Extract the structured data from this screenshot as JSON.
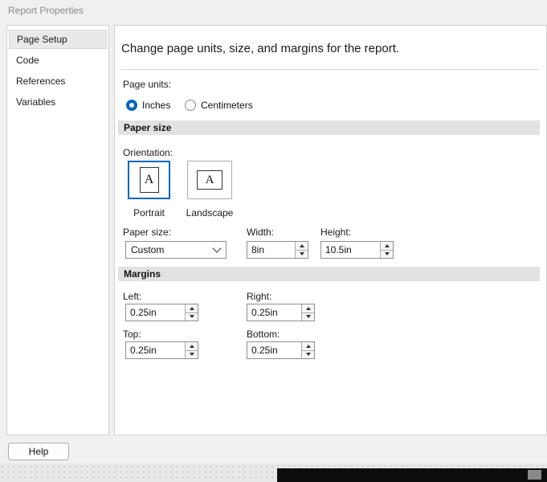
{
  "dialog": {
    "title": "Report Properties",
    "help_label": "Help"
  },
  "sidebar": {
    "items": [
      {
        "label": "Page Setup",
        "selected": true
      },
      {
        "label": "Code",
        "selected": false
      },
      {
        "label": "References",
        "selected": false
      },
      {
        "label": "Variables",
        "selected": false
      }
    ]
  },
  "main": {
    "description": "Change page units, size, and margins for the report.",
    "page_units": {
      "label": "Page units:",
      "options": [
        {
          "label": "Inches",
          "selected": true
        },
        {
          "label": "Centimeters",
          "selected": false
        }
      ]
    },
    "paper": {
      "section_title": "Paper size",
      "orientation_label": "Orientation:",
      "icon_letter": "A",
      "orientations": [
        {
          "label": "Portrait",
          "selected": true
        },
        {
          "label": "Landscape",
          "selected": false
        }
      ],
      "size_label": "Paper size:",
      "size_value": "Custom",
      "width_label": "Width:",
      "width_value": "8in",
      "height_label": "Height:",
      "height_value": "10.5in"
    },
    "margins": {
      "section_title": "Margins",
      "left_label": "Left:",
      "left_value": "0.25in",
      "right_label": "Right:",
      "right_value": "0.25in",
      "top_label": "Top:",
      "top_value": "0.25in",
      "bottom_label": "Bottom:",
      "bottom_value": "0.25in"
    }
  },
  "colors": {
    "accent": "#0067c0",
    "section_bar": "#e2e2e2",
    "dialog_bg": "#f0f0f0"
  }
}
